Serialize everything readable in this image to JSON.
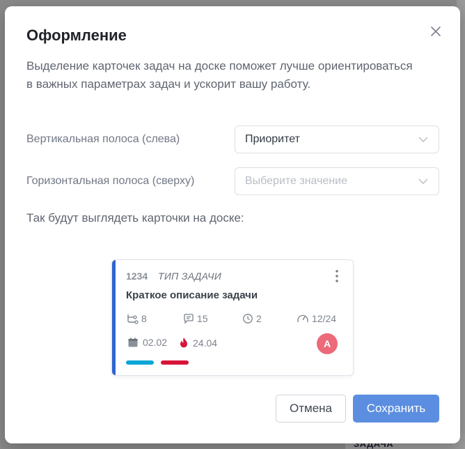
{
  "dialog": {
    "title": "Оформление",
    "description": "Выделение карточек задач на доске поможет лучше ориентироваться в важных параметрах задач и ускорит вашу работу.",
    "vertical_label": "Вертикальная полоса (слева)",
    "vertical_value": "Приоритет",
    "horizontal_label": "Горизонтальная полоса (сверху)",
    "horizontal_placeholder": "Выберите значение",
    "preview_label": "Так будут выглядеть карточки на доске:",
    "cancel_label": "Отмена",
    "save_label": "Сохранить"
  },
  "card": {
    "id": "1234",
    "type": "ТИП ЗАДАЧИ",
    "title": "Краткое описание задачи",
    "subtasks": "8",
    "comments": "15",
    "time": "2",
    "progress": "12/24",
    "start_date": "02.02",
    "deadline": "24.04",
    "avatar_initial": "А",
    "stripe_color": "#2f63d0",
    "tag_colors": [
      "#0aa6d6",
      "#d8143a"
    ]
  },
  "background": {
    "bottom_text": "ЗАДАЧА"
  }
}
